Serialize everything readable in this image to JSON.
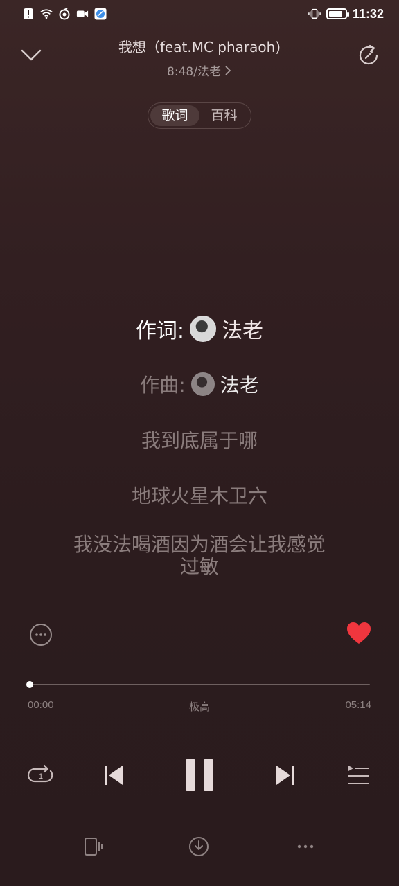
{
  "status_bar": {
    "icons": [
      "alert-icon",
      "wifi-icon",
      "app-icon",
      "video-icon",
      "browser-icon"
    ],
    "right_icons": [
      "vibrate-icon",
      "battery-icon"
    ],
    "battery_level": 0.85,
    "time": "11:32"
  },
  "header": {
    "title": "我想（feat.MC pharaoh)",
    "subtitle": "8:48/法老",
    "subtitle_chevron": "›"
  },
  "tabs": [
    {
      "label": "歌词",
      "active": true
    },
    {
      "label": "百科",
      "active": false
    }
  ],
  "lyrics": {
    "lyricist_label": "作词:",
    "lyricist_name": "法老",
    "composer_label": "作曲:",
    "composer_name": "法老",
    "lines": [
      "我到底属于哪",
      "地球火星木卫六"
    ],
    "line_multi_1": "我没法喝酒因为酒会让我感觉",
    "line_multi_2": "过敏"
  },
  "player": {
    "current_time": "00:00",
    "quality": "极高",
    "total_time": "05:14",
    "progress": 0.0,
    "liked": true,
    "accent_color": "#f0363e"
  }
}
